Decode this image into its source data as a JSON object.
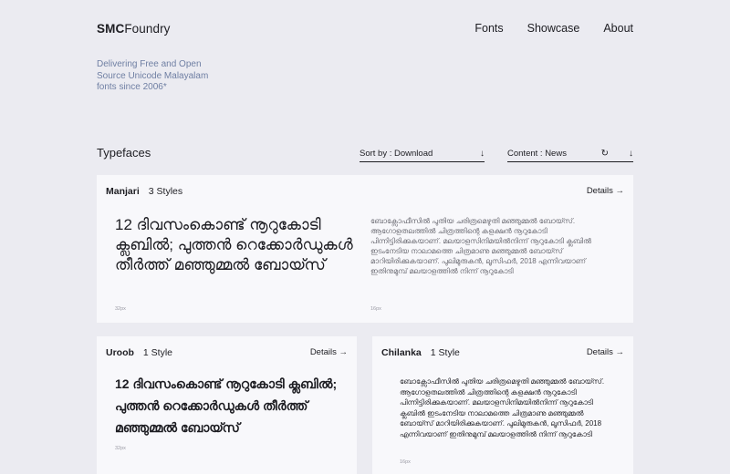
{
  "header": {
    "logo_bold": "SMC",
    "logo_light": "Foundry",
    "nav": [
      "Fonts",
      "Showcase",
      "About"
    ]
  },
  "tagline": "Delivering Free and Open Source Unicode Malayalam fonts since 2006*",
  "toolbar": {
    "title": "Typefaces",
    "sort_label": "Sort by : Download",
    "content_label": "Content : News"
  },
  "icons": {
    "sort": "arrow-down-icon",
    "refresh": "refresh-icon",
    "content": "arrow-down-icon"
  },
  "cards": [
    {
      "name": "Manjari",
      "styles": "3 Styles",
      "details": "Details →",
      "large_text": "12 ദിവസംകൊണ്ട് നൂറുകോടി ക്ലബിൽ; പുത്തൻ റെക്കോർഡുകൾ തീർത്ത് മഞ്ഞുമ്മൽ ബോയ്സ്",
      "large_size": "32px",
      "small_text": "ബോക്സോഫീസിൽ പുതിയ ചരിത്രമെഴുതി മഞ്ഞുമ്മൽ ബോയ്സ്. ആഗോളതലത്തിൽ ചിത്രത്തിന്റെ കളക്ഷൻ നൂറുകോടി പിന്നിട്ടിരിക്കുകയാണ്. മലയാളസിനിമയിൽനിന്ന് നൂറുകോടി ക്ലബിൽ ഇടംനേടിയ നാലാമത്തെ ചിത്രമാണു മഞ്ഞുമ്മൽ ബോയ്സ് മാറിയിരിക്കുകയാണ്. പുലിമുരുകൻ, ലൂസിഫർ, 2018 എന്നിവയാണ് ഇതിനുമുമ്പ് മലയാളത്തിൽ നിന്ന് നൂറുകോടി",
      "small_size": "16px"
    },
    {
      "name": "Uroob",
      "styles": "1 Style",
      "details": "Details →",
      "large_text": "12 ദിവസംകൊണ്ട് നൂറുകോടി ക്ലബിൽ; പുത്തൻ റെക്കോർഡുകൾ തീർത്ത് മഞ്ഞുമ്മൽ ബോയ്സ്",
      "large_size": "32px"
    },
    {
      "name": "Chilanka",
      "styles": "1 Style",
      "details": "Details →",
      "small_text": "ബോക്സോഫീസിൽ പുതിയ ചരിത്രമെഴുതി മഞ്ഞുമ്മൽ ബോയ്സ്. ആഗോളതലത്തിൽ ചിത്രത്തിന്റെ കളക്ഷൻ നൂറുകോടി പിന്നിട്ടിരിക്കുകയാണ്. മലയാളസിനിമയിൽനിന്ന് നൂറുകോടി ക്ലബിൽ ഇടംനേടിയ നാലാമത്തെ ചിത്രമാണു മഞ്ഞുമ്മൽ ബോയ്സ് മാറിയിരിക്കുകയാണ്. പുലിമുരുകൻ, ലൂസിഫർ, 2018 എന്നിവയാണ് ഇതിനുമുമ്പ് മലയാളത്തിൽ നിന്ന് നൂറുകോടി",
      "small_size": "16px"
    }
  ]
}
